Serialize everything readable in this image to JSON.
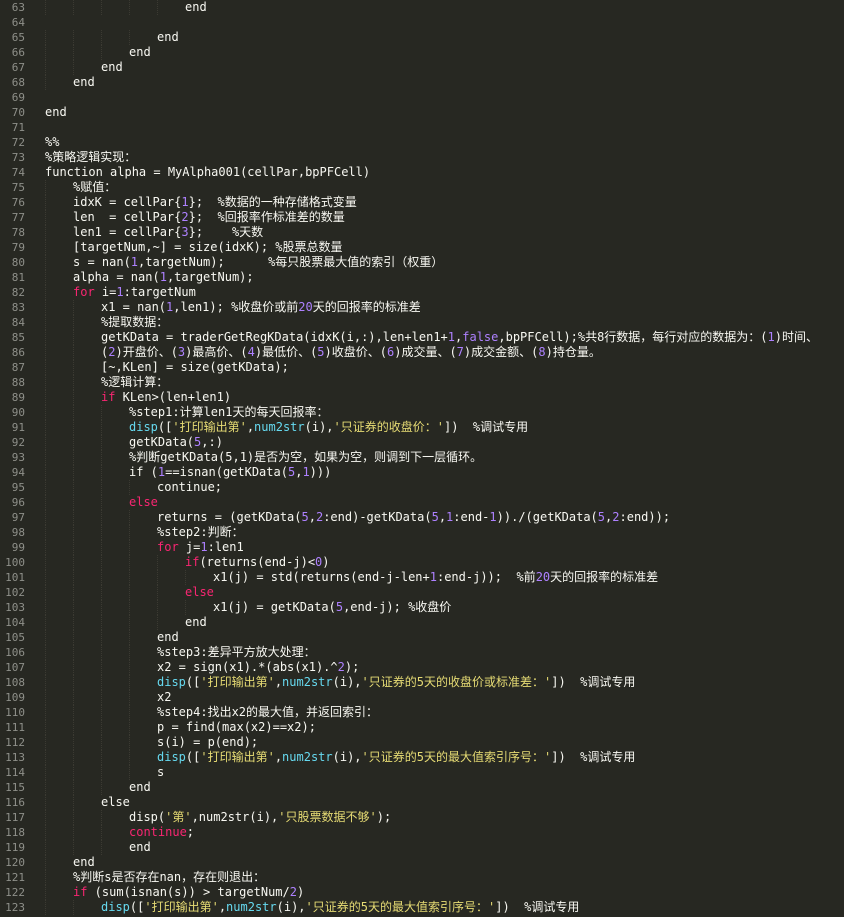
{
  "editor": {
    "theme_colors": {
      "background": "#272822",
      "text": "#f8f8f2",
      "keyword": "#f92672",
      "string": "#e6db74",
      "number": "#ae81ff",
      "builtin": "#66d9ef",
      "line_number": "#8f908a"
    },
    "lines": [
      {
        "n": "63",
        "indent": 5,
        "tokens": [
          [
            "end",
            ""
          ]
        ]
      },
      {
        "n": "64",
        "indent": 0,
        "tokens": []
      },
      {
        "n": "65",
        "indent": 4,
        "tokens": [
          [
            "end",
            ""
          ]
        ]
      },
      {
        "n": "66",
        "indent": 3,
        "tokens": [
          [
            "end",
            ""
          ]
        ]
      },
      {
        "n": "67",
        "indent": 2,
        "tokens": [
          [
            "end",
            ""
          ]
        ]
      },
      {
        "n": "68",
        "indent": 1,
        "tokens": [
          [
            "end",
            ""
          ]
        ]
      },
      {
        "n": "69",
        "indent": 0,
        "tokens": []
      },
      {
        "n": "70",
        "indent": 0,
        "tokens": [
          [
            "end",
            ""
          ]
        ]
      },
      {
        "n": "71",
        "indent": 0,
        "tokens": []
      },
      {
        "n": "72",
        "indent": 0,
        "tokens": [
          [
            "%%",
            "cm"
          ]
        ]
      },
      {
        "n": "73",
        "indent": 0,
        "tokens": [
          [
            "%策略逻辑实现：",
            "cm"
          ]
        ]
      },
      {
        "n": "74",
        "indent": 0,
        "tokens": [
          [
            "function alpha = MyAlpha001(cellPar,bpPFCell)",
            ""
          ]
        ]
      },
      {
        "n": "75",
        "indent": 1,
        "tokens": [
          [
            "%赋值：",
            "cm"
          ]
        ]
      },
      {
        "n": "76",
        "indent": 1,
        "tokens": [
          [
            "idxK = cellPar{",
            ""
          ],
          [
            "1",
            "num"
          ],
          [
            "};  %数据的一种存储格式变量",
            ""
          ]
        ]
      },
      {
        "n": "77",
        "indent": 1,
        "tokens": [
          [
            "len  = cellPar{",
            ""
          ],
          [
            "2",
            "num"
          ],
          [
            "};  %回报率作标准差的数量",
            ""
          ]
        ]
      },
      {
        "n": "78",
        "indent": 1,
        "tokens": [
          [
            "len1 = cellPar{",
            ""
          ],
          [
            "3",
            "num"
          ],
          [
            "};    %天数",
            ""
          ]
        ]
      },
      {
        "n": "79",
        "indent": 1,
        "tokens": [
          [
            "[targetNum,~] = size(idxK); %股票总数量",
            ""
          ]
        ]
      },
      {
        "n": "80",
        "indent": 1,
        "tokens": [
          [
            "s = nan(",
            ""
          ],
          [
            "1",
            "num"
          ],
          [
            ",targetNum);      %每只股票最大值的索引（权重）",
            ""
          ]
        ]
      },
      {
        "n": "81",
        "indent": 1,
        "tokens": [
          [
            "alpha = nan(",
            ""
          ],
          [
            "1",
            "num"
          ],
          [
            ",targetNum);",
            ""
          ]
        ]
      },
      {
        "n": "82",
        "indent": 1,
        "tokens": [
          [
            "for",
            "kw"
          ],
          [
            " i=",
            ""
          ],
          [
            "1",
            "num"
          ],
          [
            ":targetNum",
            ""
          ]
        ]
      },
      {
        "n": "83",
        "indent": 2,
        "tokens": [
          [
            "x1 = nan(",
            ""
          ],
          [
            "1",
            "num"
          ],
          [
            ",len1); %收盘价或前",
            ""
          ],
          [
            "20",
            "num"
          ],
          [
            "天的回报率的标准差",
            ""
          ]
        ]
      },
      {
        "n": "84",
        "indent": 2,
        "tokens": [
          [
            "%提取数据：",
            "cm"
          ]
        ]
      },
      {
        "n": "85",
        "indent": 2,
        "tokens": [
          [
            "getKData = traderGetRegKData(idxK(i,:),len+len1+",
            ""
          ],
          [
            "1",
            "num"
          ],
          [
            ",",
            ""
          ],
          [
            "false",
            "num"
          ],
          [
            ",bpPFCell);%共8行数据，每行对应的数据为：(",
            ""
          ],
          [
            "1",
            "num"
          ],
          [
            ")时间、",
            ""
          ]
        ]
      },
      {
        "n": "86",
        "indent": 2,
        "tokens": [
          [
            "(",
            ""
          ],
          [
            "2",
            "num"
          ],
          [
            ")开盘价、(",
            ""
          ],
          [
            "3",
            "num"
          ],
          [
            ")最高价、(",
            ""
          ],
          [
            "4",
            "num"
          ],
          [
            ")最低价、(",
            ""
          ],
          [
            "5",
            "num"
          ],
          [
            ")收盘价、(",
            ""
          ],
          [
            "6",
            "num"
          ],
          [
            ")成交量、(",
            ""
          ],
          [
            "7",
            "num"
          ],
          [
            ")成交金额、(",
            ""
          ],
          [
            "8",
            "num"
          ],
          [
            ")持仓量。",
            ""
          ]
        ],
        "cont": true
      },
      {
        "n": "87",
        "indent": 2,
        "tokens": [
          [
            "[~,KLen] = size(getKData);",
            ""
          ]
        ]
      },
      {
        "n": "88",
        "indent": 2,
        "tokens": [
          [
            "%逻辑计算：",
            "cm"
          ]
        ]
      },
      {
        "n": "89",
        "indent": 2,
        "tokens": [
          [
            "if",
            "kw"
          ],
          [
            " KLen>(len+len1)",
            ""
          ]
        ]
      },
      {
        "n": "90",
        "indent": 3,
        "tokens": [
          [
            "%step1:计算len1天的每天回报率：",
            "cm"
          ]
        ]
      },
      {
        "n": "91",
        "indent": 3,
        "tokens": [
          [
            "disp",
            "fn"
          ],
          [
            "([",
            ""
          ],
          [
            "'打印输出第'",
            "str"
          ],
          [
            ",",
            ""
          ],
          [
            "num2str",
            "fn"
          ],
          [
            "(i),",
            ""
          ],
          [
            "'只证券的收盘价：'",
            "str"
          ],
          [
            "])  %调试专用",
            ""
          ]
        ]
      },
      {
        "n": "92",
        "indent": 3,
        "tokens": [
          [
            "getKData(",
            ""
          ],
          [
            "5",
            "num"
          ],
          [
            ",:)",
            ""
          ]
        ]
      },
      {
        "n": "93",
        "indent": 3,
        "tokens": [
          [
            "%判断getKData(5,1)是否为空，如果为空，则调到下一层循环。",
            "cm"
          ]
        ]
      },
      {
        "n": "94",
        "indent": 3,
        "tokens": [
          [
            "if (",
            ""
          ],
          [
            "1",
            "num"
          ],
          [
            "==isnan(getKData(",
            ""
          ],
          [
            "5",
            "num"
          ],
          [
            ",",
            ""
          ],
          [
            "1",
            "num"
          ],
          [
            ")))",
            ""
          ]
        ]
      },
      {
        "n": "95",
        "indent": 4,
        "tokens": [
          [
            "continue;",
            ""
          ]
        ]
      },
      {
        "n": "96",
        "indent": 3,
        "tokens": [
          [
            "else",
            "kw"
          ]
        ]
      },
      {
        "n": "97",
        "indent": 4,
        "tokens": [
          [
            "returns = (getKData(",
            ""
          ],
          [
            "5",
            "num"
          ],
          [
            ",",
            ""
          ],
          [
            "2",
            "num"
          ],
          [
            ":end)-getKData(",
            ""
          ],
          [
            "5",
            "num"
          ],
          [
            ",",
            ""
          ],
          [
            "1",
            "num"
          ],
          [
            ":end-",
            ""
          ],
          [
            "1",
            "num"
          ],
          [
            "))./(getKData(",
            ""
          ],
          [
            "5",
            "num"
          ],
          [
            ",",
            ""
          ],
          [
            "2",
            "num"
          ],
          [
            ":end));",
            ""
          ]
        ]
      },
      {
        "n": "98",
        "indent": 4,
        "tokens": [
          [
            "%step2:判断：",
            "cm"
          ]
        ]
      },
      {
        "n": "99",
        "indent": 4,
        "tokens": [
          [
            "for",
            "kw"
          ],
          [
            " j=",
            ""
          ],
          [
            "1",
            "num"
          ],
          [
            ":len1",
            ""
          ]
        ]
      },
      {
        "n": "100",
        "indent": 5,
        "tokens": [
          [
            "if",
            "kw"
          ],
          [
            "(returns(end-j)<",
            ""
          ],
          [
            "0",
            "num"
          ],
          [
            ")",
            ""
          ]
        ]
      },
      {
        "n": "101",
        "indent": 6,
        "tokens": [
          [
            "x1(j) = std(returns(end-j-len+",
            ""
          ],
          [
            "1",
            "num"
          ],
          [
            ":end-j));  %前",
            ""
          ],
          [
            "20",
            "num"
          ],
          [
            "天的回报率的标准差",
            ""
          ]
        ]
      },
      {
        "n": "102",
        "indent": 5,
        "tokens": [
          [
            "else",
            "kw"
          ]
        ]
      },
      {
        "n": "103",
        "indent": 6,
        "tokens": [
          [
            "x1(j) = getKData(",
            ""
          ],
          [
            "5",
            "num"
          ],
          [
            ",end-j); %收盘价",
            ""
          ]
        ]
      },
      {
        "n": "104",
        "indent": 5,
        "tokens": [
          [
            "end",
            ""
          ]
        ]
      },
      {
        "n": "105",
        "indent": 4,
        "tokens": [
          [
            "end",
            ""
          ]
        ]
      },
      {
        "n": "106",
        "indent": 4,
        "tokens": [
          [
            "%step3:差异平方放大处理：",
            "cm"
          ]
        ]
      },
      {
        "n": "107",
        "indent": 4,
        "tokens": [
          [
            "x2 = sign(x1).*(abs(x1).^",
            ""
          ],
          [
            "2",
            "num"
          ],
          [
            ");",
            ""
          ]
        ]
      },
      {
        "n": "108",
        "indent": 4,
        "tokens": [
          [
            "disp",
            "fn"
          ],
          [
            "([",
            ""
          ],
          [
            "'打印输出第'",
            "str"
          ],
          [
            ",",
            ""
          ],
          [
            "num2str",
            "fn"
          ],
          [
            "(i),",
            ""
          ],
          [
            "'只证券的5天的收盘价或标准差：'",
            "str"
          ],
          [
            "])  %调试专用",
            ""
          ]
        ]
      },
      {
        "n": "109",
        "indent": 4,
        "tokens": [
          [
            "x2",
            ""
          ]
        ]
      },
      {
        "n": "110",
        "indent": 4,
        "tokens": [
          [
            "%step4:找出x2的最大值，并返回索引：",
            "cm"
          ]
        ]
      },
      {
        "n": "111",
        "indent": 4,
        "tokens": [
          [
            "p = find(max(x2)==x2);",
            ""
          ]
        ]
      },
      {
        "n": "112",
        "indent": 4,
        "tokens": [
          [
            "s(i) = p(end);",
            ""
          ]
        ]
      },
      {
        "n": "113",
        "indent": 4,
        "tokens": [
          [
            "disp",
            "fn"
          ],
          [
            "([",
            ""
          ],
          [
            "'打印输出第'",
            "str"
          ],
          [
            ",",
            ""
          ],
          [
            "num2str",
            "fn"
          ],
          [
            "(i),",
            ""
          ],
          [
            "'只证券的5天的最大值索引序号：'",
            "str"
          ],
          [
            "])  %调试专用",
            ""
          ]
        ]
      },
      {
        "n": "114",
        "indent": 4,
        "tokens": [
          [
            "s",
            ""
          ]
        ]
      },
      {
        "n": "115",
        "indent": 3,
        "tokens": [
          [
            "end",
            ""
          ]
        ]
      },
      {
        "n": "116",
        "indent": 2,
        "tokens": [
          [
            "else",
            ""
          ]
        ]
      },
      {
        "n": "117",
        "indent": 3,
        "tokens": [
          [
            "disp(",
            ""
          ],
          [
            "'第'",
            "str"
          ],
          [
            ",num2str(i),",
            ""
          ],
          [
            "'只股票数据不够'",
            "str"
          ],
          [
            ");",
            ""
          ]
        ]
      },
      {
        "n": "118",
        "indent": 3,
        "tokens": [
          [
            "continue",
            "kw"
          ],
          [
            ";",
            ""
          ]
        ]
      },
      {
        "n": "119",
        "indent": 3,
        "tokens": [
          [
            "end",
            ""
          ]
        ]
      },
      {
        "n": "120",
        "indent": 1,
        "tokens": [
          [
            "end",
            ""
          ]
        ]
      },
      {
        "n": "121",
        "indent": 1,
        "tokens": [
          [
            "%判断s是否存在nan，存在则退出：",
            "cm"
          ]
        ]
      },
      {
        "n": "122",
        "indent": 1,
        "tokens": [
          [
            "if",
            "kw"
          ],
          [
            " (sum(isnan(s)) > targetNum/",
            ""
          ],
          [
            "2",
            "num"
          ],
          [
            ")",
            ""
          ]
        ]
      },
      {
        "n": "123",
        "indent": 2,
        "tokens": [
          [
            "disp",
            "fn"
          ],
          [
            "([",
            ""
          ],
          [
            "'打印输出第'",
            "str"
          ],
          [
            ",",
            ""
          ],
          [
            "num2str",
            "fn"
          ],
          [
            "(i),",
            ""
          ],
          [
            "'只证券的5天的最大值索引序号：'",
            "str"
          ],
          [
            "])  %调试专用",
            ""
          ]
        ]
      }
    ]
  }
}
